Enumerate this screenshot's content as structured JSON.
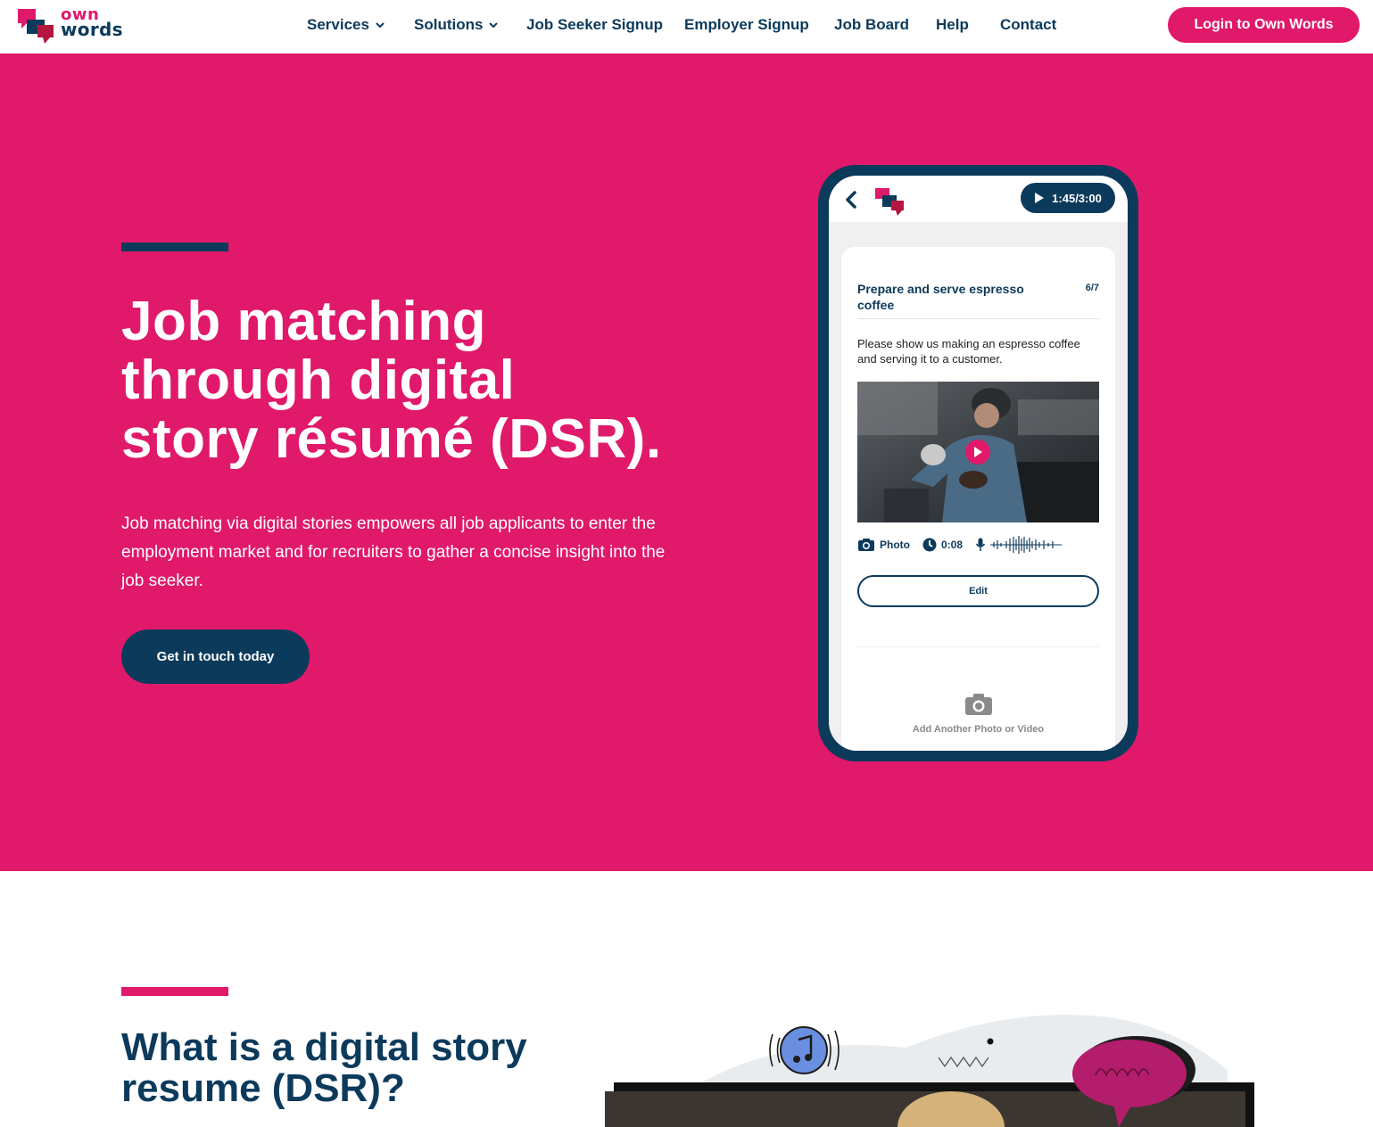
{
  "brand": {
    "logo_line1": "own",
    "logo_line2": "words",
    "primary_color": "#e0196a",
    "dark_color": "#0c3a5b"
  },
  "nav": {
    "items": [
      {
        "label": "Services",
        "has_dropdown": true
      },
      {
        "label": "Solutions",
        "has_dropdown": true
      },
      {
        "label": "Job Seeker Signup",
        "has_dropdown": false
      },
      {
        "label": "Employer Signup",
        "has_dropdown": false
      },
      {
        "label": "Job Board",
        "has_dropdown": false
      },
      {
        "label": "Help",
        "has_dropdown": false
      },
      {
        "label": "Contact",
        "has_dropdown": false
      }
    ],
    "login_label": "Login to Own Words"
  },
  "hero": {
    "title_lines": [
      "Job matching",
      "through digital",
      "story résumé (DSR)."
    ],
    "description": "Job matching via digital stories empowers all job applicants to enter the employment market and for recruiters to gather a concise insight into the job seeker.",
    "cta_label": "Get in touch today"
  },
  "phone": {
    "timer": "1:45/3:00",
    "card": {
      "title": "Prepare and serve espresso coffee",
      "count": "6/7",
      "prompt": "Please show us making an espresso coffee and serving it to a customer.",
      "meta_photo": "Photo",
      "meta_duration": "0:08",
      "edit_label": "Edit",
      "add_media_label": "Add Another Photo or Video"
    }
  },
  "section2": {
    "title_lines": [
      "What is a digital story",
      "resume (DSR)?"
    ]
  }
}
